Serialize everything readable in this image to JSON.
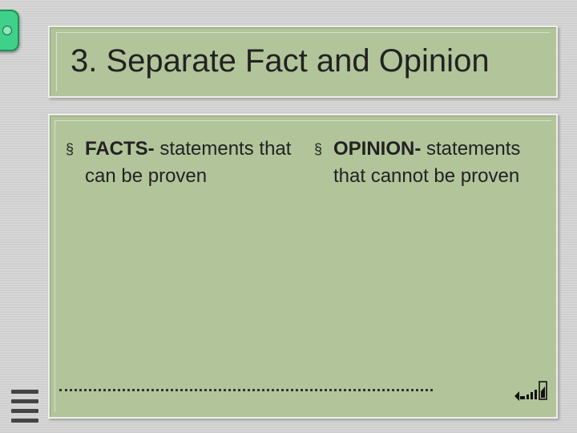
{
  "slide": {
    "title": "3. Separate Fact and Opinion",
    "left_column": {
      "term": "FACTS-",
      "definition": " statements that can be proven"
    },
    "right_column": {
      "term": "OPINION-",
      "definition": " statements that cannot be proven"
    },
    "bullet_symbol": "§"
  },
  "colors": {
    "panel": "#b2c49a",
    "tab": "#3fd08a",
    "text": "#222222"
  },
  "icons": [
    "signal-icon",
    "menu-icon",
    "ring-icon"
  ]
}
